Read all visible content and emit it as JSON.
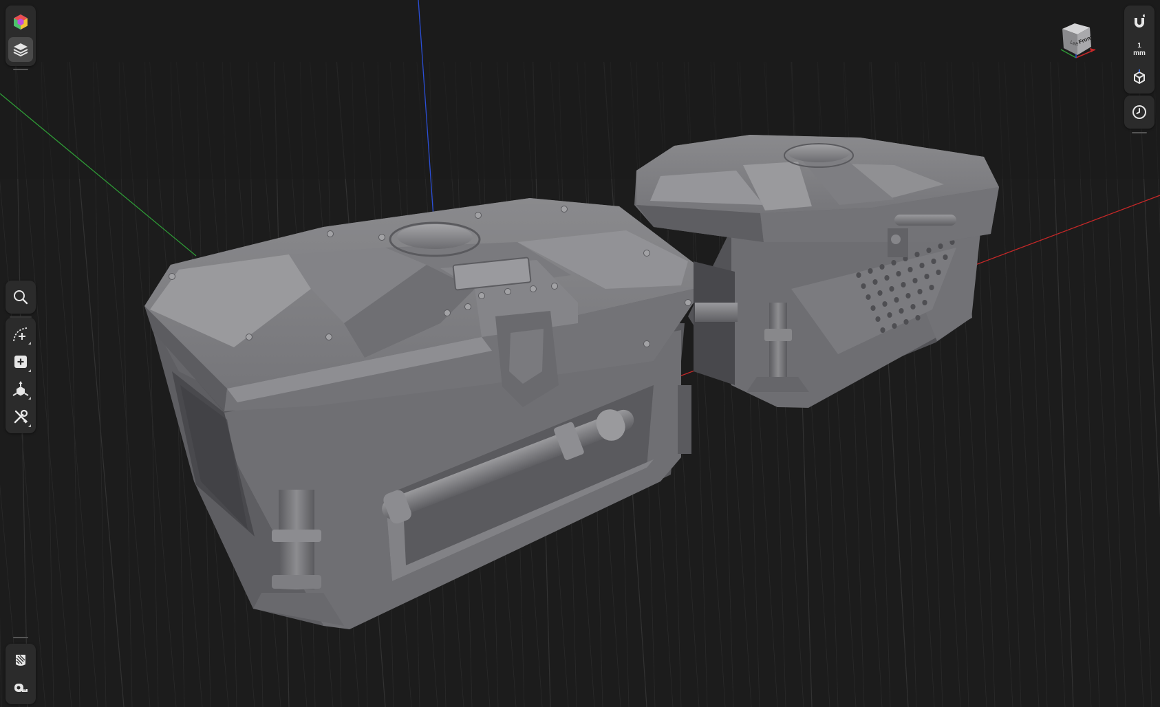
{
  "app": {
    "colors": {
      "background": "#1c1c1c",
      "grid_minor": "#2a2a2a",
      "grid_major": "#323232",
      "axis_x": "#c62828",
      "axis_y": "#2e9a36",
      "axis_z": "#2b4fd8",
      "toolbar_bg": "#2b2b2b",
      "icon": "#e6e6e6",
      "model_gray": "#7a7a7d"
    }
  },
  "left_toolbar_top": {
    "items": [
      {
        "name": "asset-library",
        "icon": "colored-cube-icon",
        "active": false
      },
      {
        "name": "layers",
        "icon": "layers-icon",
        "active": true
      }
    ]
  },
  "left_toolbar_mid": {
    "items": [
      {
        "name": "search",
        "icon": "search-icon"
      },
      {
        "name": "curve-tool",
        "icon": "curve-add-icon"
      },
      {
        "name": "add-primitive",
        "icon": "add-square-icon"
      },
      {
        "name": "transform",
        "icon": "transform-gizmo-icon"
      },
      {
        "name": "tools",
        "icon": "wrench-screwdriver-icon"
      }
    ]
  },
  "left_toolbar_bottom": {
    "items": [
      {
        "name": "material",
        "icon": "shader-ball-icon"
      },
      {
        "name": "measure",
        "icon": "tape-measure-icon"
      }
    ]
  },
  "right_toolbar": {
    "snap_icon": "magnet-icon",
    "snap_value": "1",
    "snap_unit": "mm",
    "view_icon": "cube-view-icon",
    "history_icon": "clock-icon"
  },
  "nav_cube": {
    "front_label": "Front",
    "left_label": "Left"
  }
}
